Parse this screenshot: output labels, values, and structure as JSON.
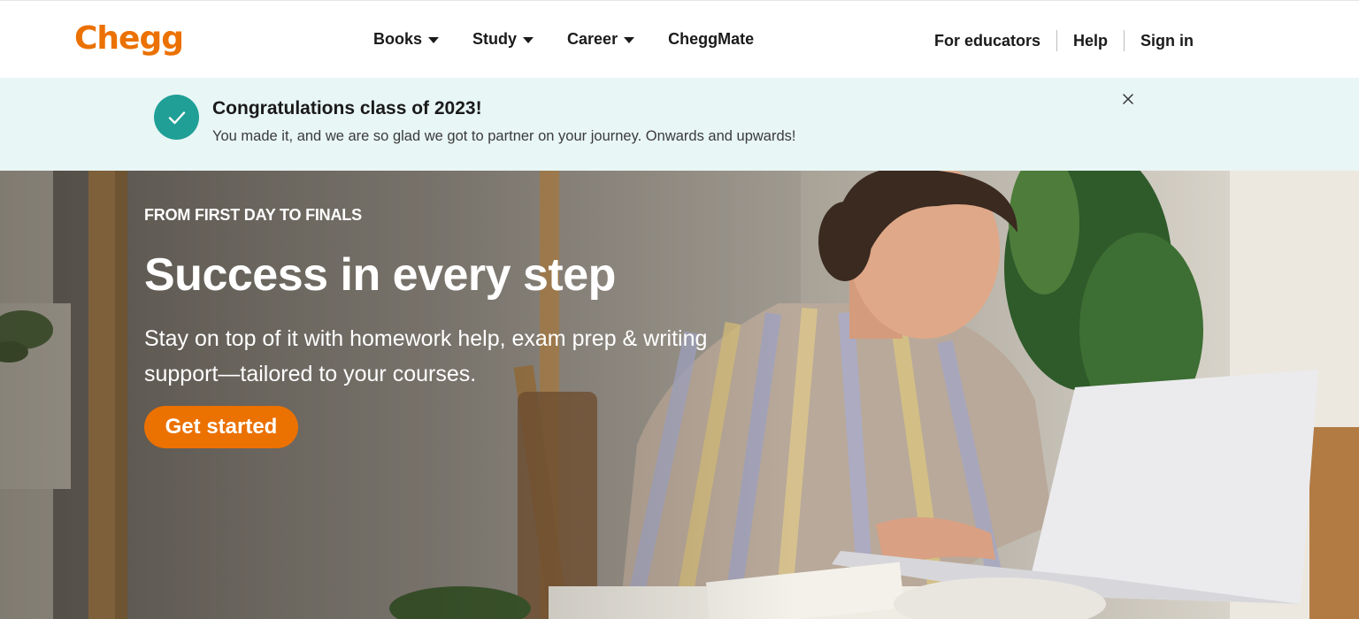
{
  "header": {
    "logo": "Chegg",
    "nav": [
      {
        "label": "Books",
        "has_dropdown": true
      },
      {
        "label": "Study",
        "has_dropdown": true
      },
      {
        "label": "Career",
        "has_dropdown": true
      },
      {
        "label": "CheggMate",
        "has_dropdown": false
      }
    ],
    "for_educators": "For educators",
    "help": "Help",
    "sign_in": "Sign in"
  },
  "banner": {
    "title": "Congratulations class of 2023!",
    "message": "You made it, and we are so glad we got to partner on your journey. Onwards and upwards!",
    "icon": "check-icon",
    "close_icon": "close-icon"
  },
  "hero": {
    "eyebrow": "FROM FIRST DAY TO FINALS",
    "headline": "Success in every step",
    "subline": "Stay on top of it with homework help, exam prep & writing support—tailored to your courses.",
    "cta": "Get started"
  },
  "colors": {
    "brand": "#eb7100",
    "banner_bg": "#e8f6f5",
    "check_circle": "#1f9f96"
  }
}
